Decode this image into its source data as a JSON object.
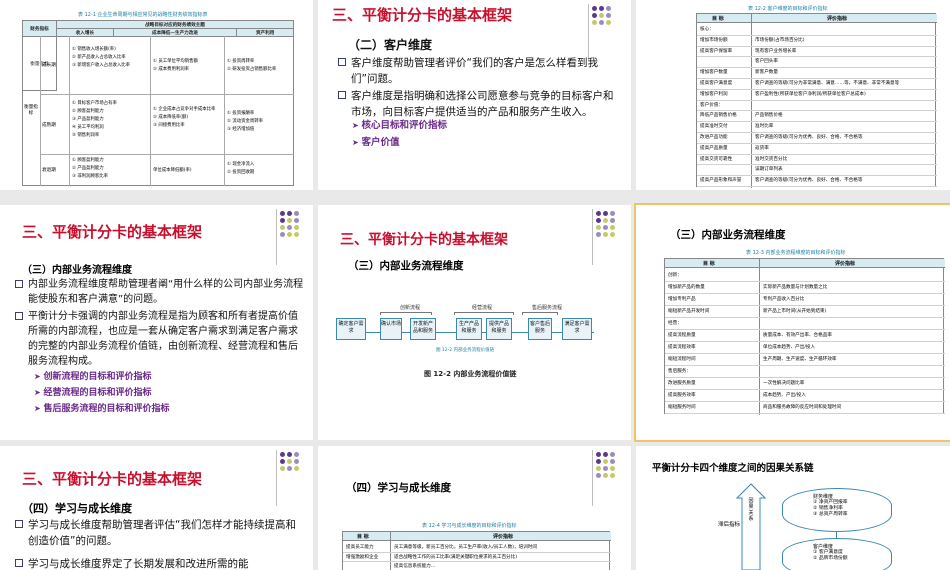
{
  "heading": "三、平衡计分卡的基本框架",
  "slide1": {
    "caption": "表 12-1  企业生命周期与相应常见的战略性财务绩效指标表",
    "col_finance": "财务指标",
    "col_group": "战略目标对应的财务绩效主题",
    "col_growth": "收入增长",
    "col_cost": "成本降低—生产力改进",
    "col_asset": "资产利用",
    "row_side": "衡量指标",
    "rows": [
      {
        "stage": "成长期",
        "growth": "① 销售收入增长额(率)\n② 新产品收入占总收入比率\n③ 新增客户收入占总收入比率",
        "cost": "① 员工单位平均销售额\n② 成本费用利润率",
        "asset": "① 投资周转率\n② 研发投资占销售额比率"
      },
      {
        "stage": "成熟期",
        "growth": "① 目标客户市场占有率\n② 顾客盈利能力\n③ 产品盈利能力\n④ 员工平均利润\n⑤ 销售利润率",
        "cost": "① 企业成本占竞争对手成本比率\n② 成本降低率(额)\n③ 间接费用比率",
        "asset": "① 投资报酬率\n② 流动资金周转率\n③ 经济增加值"
      },
      {
        "stage": "衰退期",
        "growth": "① 顾客盈利能力\n② 产品盈利能力\n③ 非利润顾客比率",
        "cost": "单位成本降低额(率)",
        "asset": "① 现金净流入\n② 投资回收期"
      }
    ]
  },
  "slide2": {
    "subtitle": "（二）客户维度",
    "p1": "客户维度帮助管理者评价“我们的客户是怎么样看到我们”问题。",
    "p2": "客户维度是指明确和选择公司愿意参与竞争的目标客户和市场，向目标客户提供适当的产品和服务产生收入。",
    "items": [
      "核心目标和评价指标",
      "客户价值"
    ]
  },
  "slide3": {
    "caption": "表 12-2  客户维度的目标和评价指标",
    "h1": "目  标",
    "h2": "评价指标",
    "rows": [
      [
        "核心：",
        ""
      ],
      [
        "增加市场份额",
        "市场份额(占市场百分比)"
      ],
      [
        "提高客户保留率",
        "现有客户业务增长率"
      ],
      [
        "",
        "客户回头率"
      ],
      [
        "增加客户数量",
        "新客户数量"
      ],
      [
        "提高客户满意度",
        "客户调查的等级(可分为非常满意、满意……等，不满意、非常不满意等"
      ],
      [
        "增加客户利润",
        "客户盈利性(所获单位客户净利润/所获单位客户总成本)"
      ],
      [
        "客户价值：",
        ""
      ],
      [
        "降低产品销售价格",
        "产品销售价格"
      ],
      [
        "提高准时交付",
        "准时比率"
      ],
      [
        "改进产品功能",
        "客户调查的等级(可分为优秀、良好、合格、不合格等"
      ],
      [
        "提高产品质量",
        "返货率"
      ],
      [
        "提高交货可靠性",
        "准时交货百分比"
      ],
      [
        "",
        "误期订单列表"
      ],
      [
        "提高产品形象和声誉",
        "客户调查的等级(可分为优秀、良好、合格、不合格等"
      ]
    ]
  },
  "slide4": {
    "subtitle": "（三）内部业务流程维度",
    "p1": "内部业务流程维度帮助管理者阐“用什么样的公司内部业务流程能使股东和客户满意”的问题。",
    "p2": "平衡计分卡强调的内部业务流程是指为顾客和所有者提高价值所需的内部流程，也应是一套从确定客户需求到满足客户需求的完整的内部业务流程价值链，由创新流程、经营流程和售后服务流程构成。",
    "items": [
      "创新流程的目标和评价指标",
      "经营流程的目标和评价指标",
      "售后服务流程的目标和评价指标"
    ]
  },
  "slide5": {
    "subtitle": "（三）内部业务流程维度",
    "lbl_innov": "创新流程",
    "lbl_oper": "经营流程",
    "lbl_after": "售后服务流程",
    "boxes": [
      "确定客户需求",
      "确认市场",
      "开发新产品和服务",
      "生产产品和服务",
      "提供产品和服务",
      "客户售后服务",
      "满足客户需求"
    ],
    "mini_caption": "图 12-2  内部业务流程价值链",
    "figure_caption": "图 12-2  内部业务流程价值链"
  },
  "slide6": {
    "subtitle": "（三）内部业务流程维度",
    "caption": "表 12-3  内部业务流程维度的目标和评价指标",
    "h1": "目  标",
    "h2": "评价指标",
    "rows": [
      [
        "创新：",
        ""
      ],
      [
        "增加新产品的数量",
        "实际新产品数量与计划数量之比"
      ],
      [
        "增加专利产品",
        "专利产品收入百分比"
      ],
      [
        "缩短新产品开发时间",
        "新产品上市时间(从开始到结束)"
      ],
      [
        "经营：",
        ""
      ],
      [
        "提高流程质量",
        "质量成本、有效产出率、合格品率"
      ],
      [
        "提高流程效率",
        "单位成本趋势、产出/投入"
      ],
      [
        "缩短流程时间",
        "生产周期、生产速度、生产循环效率"
      ],
      [
        "售后服务：",
        ""
      ],
      [
        "改进服务质量",
        "一次性解决问题比率"
      ],
      [
        "提高服务效率",
        "成本趋势、产出/投入"
      ],
      [
        "缩短服务时间",
        "商品和服务故障的反应时间和处理时间"
      ]
    ]
  },
  "slide7": {
    "subtitle": "（四）学习与成长维度",
    "p1": "学习与成长维度帮助管理者评估“我们怎样才能持续提高和创造价值”的问题。",
    "p2": "学习与成长维度界定了长期发展和改进所需的能"
  },
  "slide8": {
    "subtitle": "（四）学习与成长维度",
    "caption": "表 12-4  学习与成长维度的目标和评价指标",
    "h1": "目  标",
    "h2": "评价指标",
    "rows": [
      [
        "提高员工能力",
        "员工满意等级，新员工百分比，员工生产率(收入/员工人数)，培训时间"
      ],
      [
        "增强激励和企业",
        "适合战略性工作的员工比率(满足关键职位要求的员工百分比)"
      ],
      [
        "",
        "提高信息系统能力…"
      ]
    ]
  },
  "slide9": {
    "title": "平衡计分卡四个维度之间的因果关系链",
    "lag": "滞后指标",
    "arrow_text": "因果关系",
    "box1_title": "财务维度",
    "box1_items": [
      "① 净资产回报率",
      "② 销售净利率",
      "③ 总资产周转率"
    ],
    "box2_title": "客户维度",
    "box2_items": [
      "① 客户满意度",
      "② 品牌市场份额"
    ]
  }
}
